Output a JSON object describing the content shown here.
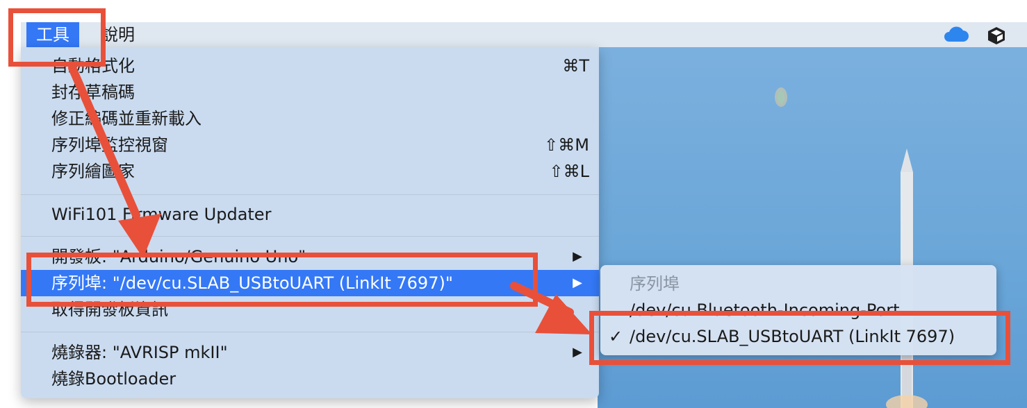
{
  "menubar": {
    "items": [
      {
        "label": "工具",
        "active": true
      },
      {
        "label": "說明",
        "active": false
      }
    ],
    "status_icons": [
      "cloud-icon",
      "package-cube-icon"
    ]
  },
  "menu": {
    "items": [
      {
        "label": "自動格式化",
        "shortcut": "⌘T"
      },
      {
        "label": "封存草稿碼",
        "shortcut": ""
      },
      {
        "label": "修正編碼並重新載入",
        "shortcut": ""
      },
      {
        "label": "序列埠監控視窗",
        "shortcut": "⇧⌘M"
      },
      {
        "label": "序列繪圖家",
        "shortcut": "⇧⌘L"
      },
      {
        "label": "WiFi101 Firmware Updater",
        "shortcut": ""
      },
      {
        "label": "開發板: \"Arduino/Genuino Uno\"",
        "submenu": true
      },
      {
        "label": "序列埠: \"/dev/cu.SLAB_USBtoUART (LinkIt 7697)\"",
        "submenu": true,
        "highlighted": true
      },
      {
        "label": "取得開發板資訊",
        "shortcut": ""
      },
      {
        "label": "燒錄器: \"AVRISP mkII\"",
        "submenu": true
      },
      {
        "label": "燒錄Bootloader",
        "shortcut": ""
      }
    ],
    "submenu_arrow": "▶"
  },
  "submenu": {
    "header": "序列埠",
    "items": [
      {
        "label": "/dev/cu.Bluetooth-Incoming-Port",
        "checked": false
      },
      {
        "label": "/dev/cu.SLAB_USBtoUART (LinkIt 7697)",
        "checked": true
      }
    ],
    "check_mark": "✓"
  },
  "colors": {
    "annotation": "#e8503a",
    "highlight": "#3478f6"
  }
}
